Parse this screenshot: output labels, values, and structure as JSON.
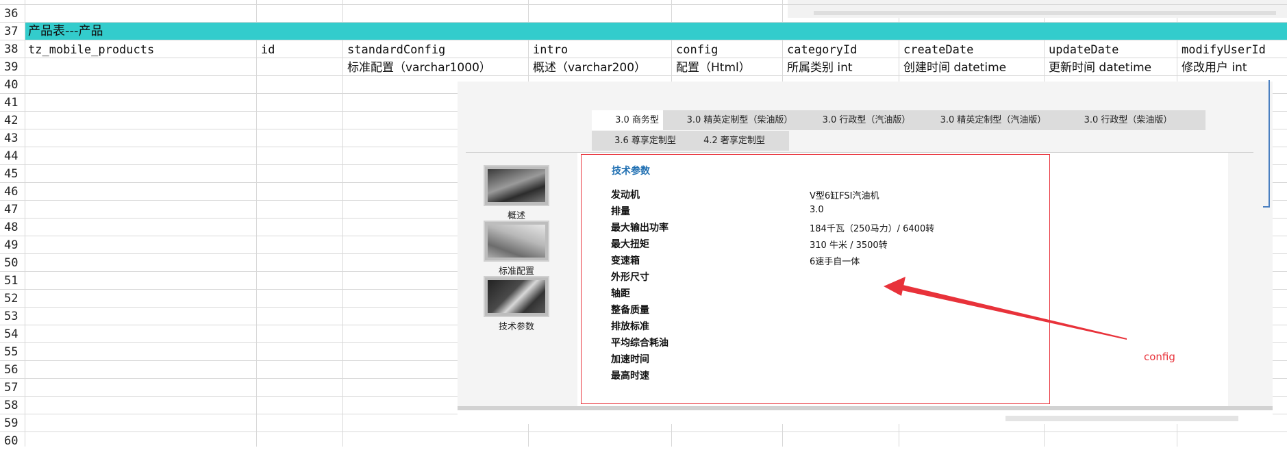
{
  "rows": [
    "36",
    "37",
    "38",
    "39",
    "40",
    "41",
    "42",
    "43",
    "44",
    "45",
    "46",
    "47",
    "48",
    "49",
    "50",
    "51",
    "52",
    "53",
    "54",
    "55",
    "56",
    "57",
    "58",
    "59",
    "60"
  ],
  "section_title": "产品表---产品",
  "header_row": {
    "table_name": "tz_mobile_products",
    "id": "id",
    "standardConfig": "standardConfig",
    "intro": "intro",
    "config": "config",
    "categoryId": "categoryId",
    "createDate": "createDate",
    "updateDate": "updateDate",
    "modifyUserId": "modifyUserId"
  },
  "desc_row": {
    "standardConfig": "标准配置（varchar1000）",
    "intro": "概述（varchar200）",
    "config": "配置（Html）",
    "categoryId": "所属类别 int",
    "createDate": "创建时间 datetime",
    "updateDate": "更新时间 datetime",
    "modifyUserId": "修改用户 int"
  },
  "embedded_page": {
    "tabs_row1": [
      "3.0 商务型",
      "3.0 精英定制型（柴油版）",
      "3.0 行政型（汽油版）",
      "3.0 精英定制型（汽油版）",
      "3.0 行政型（柴油版）"
    ],
    "tabs_row2": [
      "3.6 尊享定制型",
      "4.2 奢享定制型"
    ],
    "sidebar": [
      "概述",
      "标准配置",
      "技术参数"
    ],
    "spec_title": "技术参数",
    "specs": [
      {
        "label": "发动机",
        "value": "V型6缸FSI汽油机"
      },
      {
        "label": "排量",
        "value": "3.0"
      },
      {
        "label": "最大输出功率",
        "value": "184千瓦（250马力）/ 6400转"
      },
      {
        "label": "最大扭矩",
        "value": "310 牛米 / 3500转"
      },
      {
        "label": "变速箱",
        "value": "6速手自一体"
      },
      {
        "label": "外形尺寸",
        "value": ""
      },
      {
        "label": "轴距",
        "value": ""
      },
      {
        "label": "整备质量",
        "value": ""
      },
      {
        "label": "排放标准",
        "value": ""
      },
      {
        "label": "平均综合耗油",
        "value": ""
      },
      {
        "label": "加速时间",
        "value": ""
      },
      {
        "label": "最高时速",
        "value": ""
      }
    ]
  },
  "annotation": {
    "label": "config",
    "color": "#e8323a"
  },
  "colors": {
    "section_fill": "#33cccc",
    "highlight": "#e8323a",
    "link": "#1f6fb2"
  }
}
